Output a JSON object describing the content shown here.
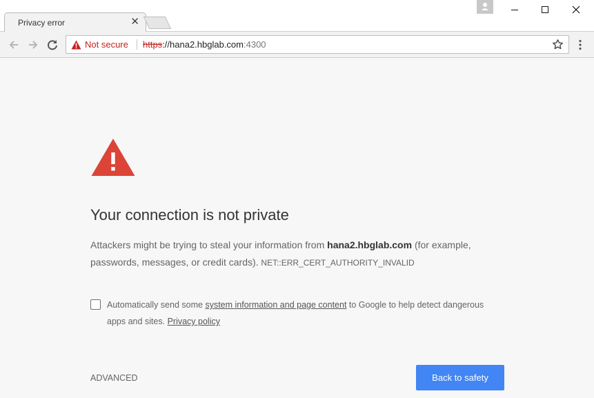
{
  "tab": {
    "title": "Privacy error",
    "close_glyph": "✕"
  },
  "toolbar": {
    "security_label": "Not secure",
    "url_scheme": "https",
    "url_rest": "://hana2.hbglab.com",
    "url_port": ":4300"
  },
  "interstitial": {
    "heading": "Your connection is not private",
    "explain_prefix": "Attackers might be trying to steal your information from ",
    "explain_host": "hana2.hbglab.com",
    "explain_suffix": " (for example, passwords, messages, or credit cards). ",
    "error_code": "NET::ERR_CERT_AUTHORITY_INVALID",
    "optin_prefix": "Automatically send some ",
    "optin_link": "system information and page content",
    "optin_middle": " to Google to help detect dangerous apps and sites. ",
    "privacy_link": "Privacy policy",
    "advanced_label": "ADVANCED",
    "back_label": "Back to safety"
  },
  "colors": {
    "warning_red": "#db4437",
    "not_secure_red": "#c5221f",
    "primary_button": "#4285f4"
  },
  "icons": {
    "warning_large": "warning-triangle-icon",
    "warning_small": "warning-icon",
    "back": "back-arrow-icon",
    "forward": "forward-arrow-icon",
    "reload": "reload-icon",
    "bookmark": "star-icon",
    "menu": "kebab-menu-icon",
    "profile": "profile-icon",
    "minimize": "minimize-icon",
    "maximize": "maximize-icon",
    "close": "close-icon"
  }
}
